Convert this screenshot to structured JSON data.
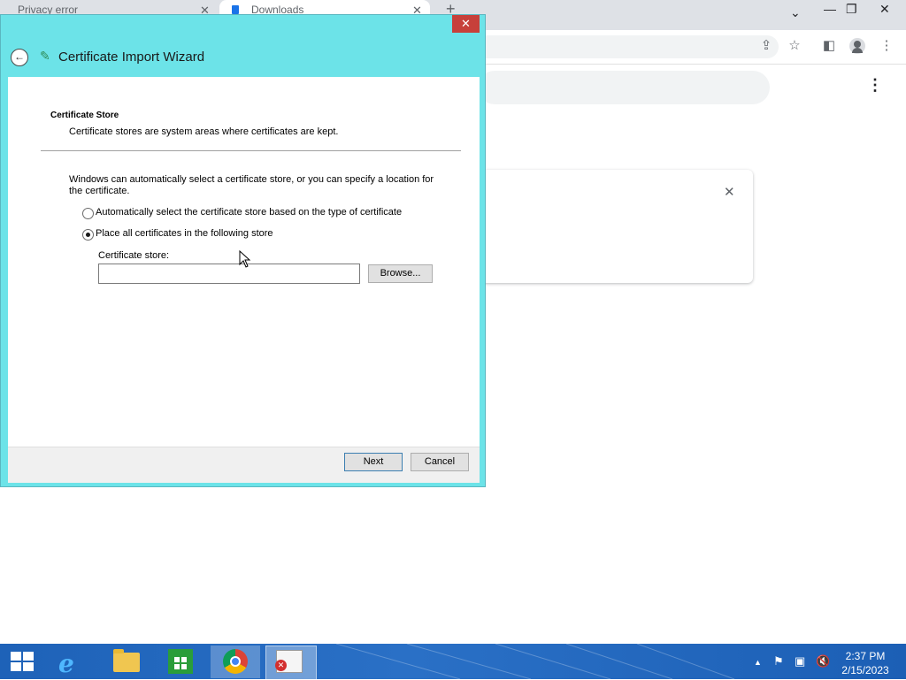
{
  "browser": {
    "tabs": [
      {
        "label": "Privacy error",
        "close": "✕"
      },
      {
        "label": "Downloads",
        "close": "✕"
      }
    ],
    "new_tab": "+",
    "window_controls": {
      "tab_search": "⌄",
      "minimize": "—",
      "restore": "❐",
      "close": "✕"
    },
    "toolbar_icons": {
      "share": "⇪",
      "bookmark": "☆",
      "sidepanel": "◧",
      "menu": "⋮"
    },
    "downloads_menu": "⋮",
    "card_close": "✕"
  },
  "dialog": {
    "title": "Certificate Import Wizard",
    "close": "✕",
    "back": "←",
    "heading": "Certificate Store",
    "subheading": "Certificate stores are system areas where certificates are kept.",
    "description": "Windows can automatically select a certificate store, or you can specify a location for the certificate.",
    "options": [
      {
        "label": "Automatically select the certificate store based on the type of certificate",
        "checked": false
      },
      {
        "label": "Place all certificates in the following store",
        "checked": true
      }
    ],
    "store_label": "Certificate store:",
    "store_value": "",
    "browse": "Browse...",
    "next": "Next",
    "cancel": "Cancel"
  },
  "taskbar": {
    "ie_glyph": "e",
    "tray": {
      "show_hidden": "▲",
      "flag": "⚑",
      "network": "▣",
      "volume": "🔇"
    },
    "time": "2:37 PM",
    "date": "2/15/2023"
  }
}
